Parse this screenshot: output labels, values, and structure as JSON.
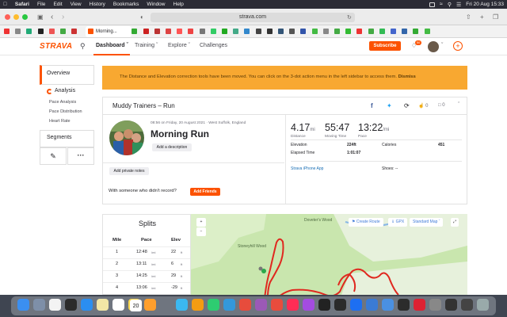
{
  "menubar": {
    "app": "Safari",
    "items": [
      "File",
      "Edit",
      "View",
      "History",
      "Bookmarks",
      "Window",
      "Help"
    ],
    "clock": "Fri 20 Aug  15:33"
  },
  "browser": {
    "address": "strava.com",
    "active_tab": "Morning..."
  },
  "strava": {
    "logo": "STRAVA",
    "nav": [
      "Dashboard",
      "Training",
      "Explore",
      "Challenges"
    ],
    "subscribe": "Subscribe",
    "notif_count": "50"
  },
  "sidebar": {
    "overview": "Overview",
    "analysis": "Analysis",
    "sub_items": [
      "Pace Analysis",
      "Pace Distribution",
      "Heart Rate"
    ],
    "segments": "Segments"
  },
  "banner": {
    "text": "The Distance and Elevation correction tools have been moved. You can click on the 3-dot action menu in the left sidebar to access them.",
    "dismiss": "Dismiss"
  },
  "activity": {
    "header": "Muddy Trainers – Run",
    "kudos": "0",
    "comments": "0",
    "datetime": "08:56 on Friday, 20 August 2021 · West Suffolk, England",
    "title": "Morning Run",
    "add_description": "Add a description",
    "add_private_notes": "Add private notes",
    "with_someone": "With someone who didn't record?",
    "add_friends": "Add Friends",
    "stats": [
      {
        "value": "4.17",
        "unit": "mi",
        "label": "Distance"
      },
      {
        "value": "55:47",
        "unit": "",
        "label": "Moving Time"
      },
      {
        "value": "13:22",
        "unit": "/mi",
        "label": "Pace"
      }
    ],
    "elevation_label": "Elevation",
    "elevation": "224ft",
    "calories_label": "Calories",
    "calories": "451",
    "elapsed_label": "Elapsed Time",
    "elapsed": "1:01:07",
    "device": "Strava iPhone App",
    "shoes": "Shoes: --"
  },
  "splits": {
    "title": "Splits",
    "headers": [
      "Mile",
      "Pace",
      "Elev"
    ],
    "rows": [
      {
        "mile": "1",
        "pace": "12:48",
        "pace_unit": "/mi",
        "elev": "22",
        "elev_unit": "ft"
      },
      {
        "mile": "2",
        "pace": "13:11",
        "pace_unit": "/mi",
        "elev": "6",
        "elev_unit": "ft"
      },
      {
        "mile": "3",
        "pace": "14:25",
        "pace_unit": "/mi",
        "elev": "29",
        "elev_unit": "ft"
      },
      {
        "mile": "4",
        "pace": "13:06",
        "pace_unit": "/mi",
        "elev": "-29",
        "elev_unit": "ft"
      }
    ]
  },
  "map": {
    "create_route": "Create Route",
    "gpx": "GPX",
    "map_type": "Standard Map",
    "zoom_in": "+",
    "zoom_out": "−",
    "place_1": "Doveter's Wood",
    "place_2": "Stoneyhill Wood"
  },
  "dock": {
    "calendar_day": "20"
  },
  "colors": {
    "brand": "#fc5200",
    "banner": "#f8a831",
    "map_bg": "#c9e6ae",
    "route": "#e0281f"
  }
}
